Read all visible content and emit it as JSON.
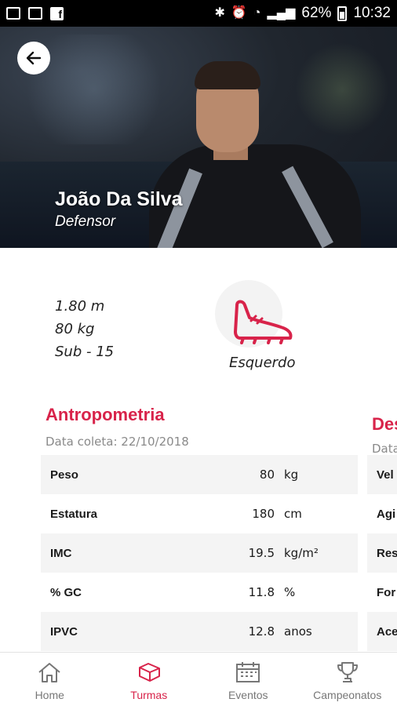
{
  "status_bar": {
    "battery": "62%",
    "time": "10:32"
  },
  "player": {
    "name": "João Da Silva",
    "position": "Defensor"
  },
  "info": {
    "height": "1.80 m",
    "weight": "80 kg",
    "category": "Sub - 15",
    "foot": "Esquerdo"
  },
  "anthropometry": {
    "title": "Antropometria",
    "date": "Data coleta: 22/10/2018",
    "rows": [
      {
        "label": "Peso",
        "value": "80",
        "unit": "kg"
      },
      {
        "label": "Estatura",
        "value": "180",
        "unit": "cm"
      },
      {
        "label": "IMC",
        "value": "19.5",
        "unit": "kg/m²"
      },
      {
        "label": "% GC",
        "value": "11.8",
        "unit": "%"
      },
      {
        "label": "IPVC",
        "value": "12.8",
        "unit": "anos"
      }
    ]
  },
  "performance": {
    "title": "Des",
    "date": "Data",
    "rows": [
      "Vel",
      "Agi",
      "Res",
      "For",
      "Ace"
    ]
  },
  "nav": {
    "items": [
      {
        "label": "Home",
        "icon": "home-icon"
      },
      {
        "label": "Turmas",
        "icon": "cleat-icon"
      },
      {
        "label": "Eventos",
        "icon": "calendar-icon"
      },
      {
        "label": "Campeonatos",
        "icon": "trophy-icon"
      }
    ],
    "active": "Turmas"
  },
  "colors": {
    "accent": "#d8234a",
    "status_bar": "#000000"
  }
}
